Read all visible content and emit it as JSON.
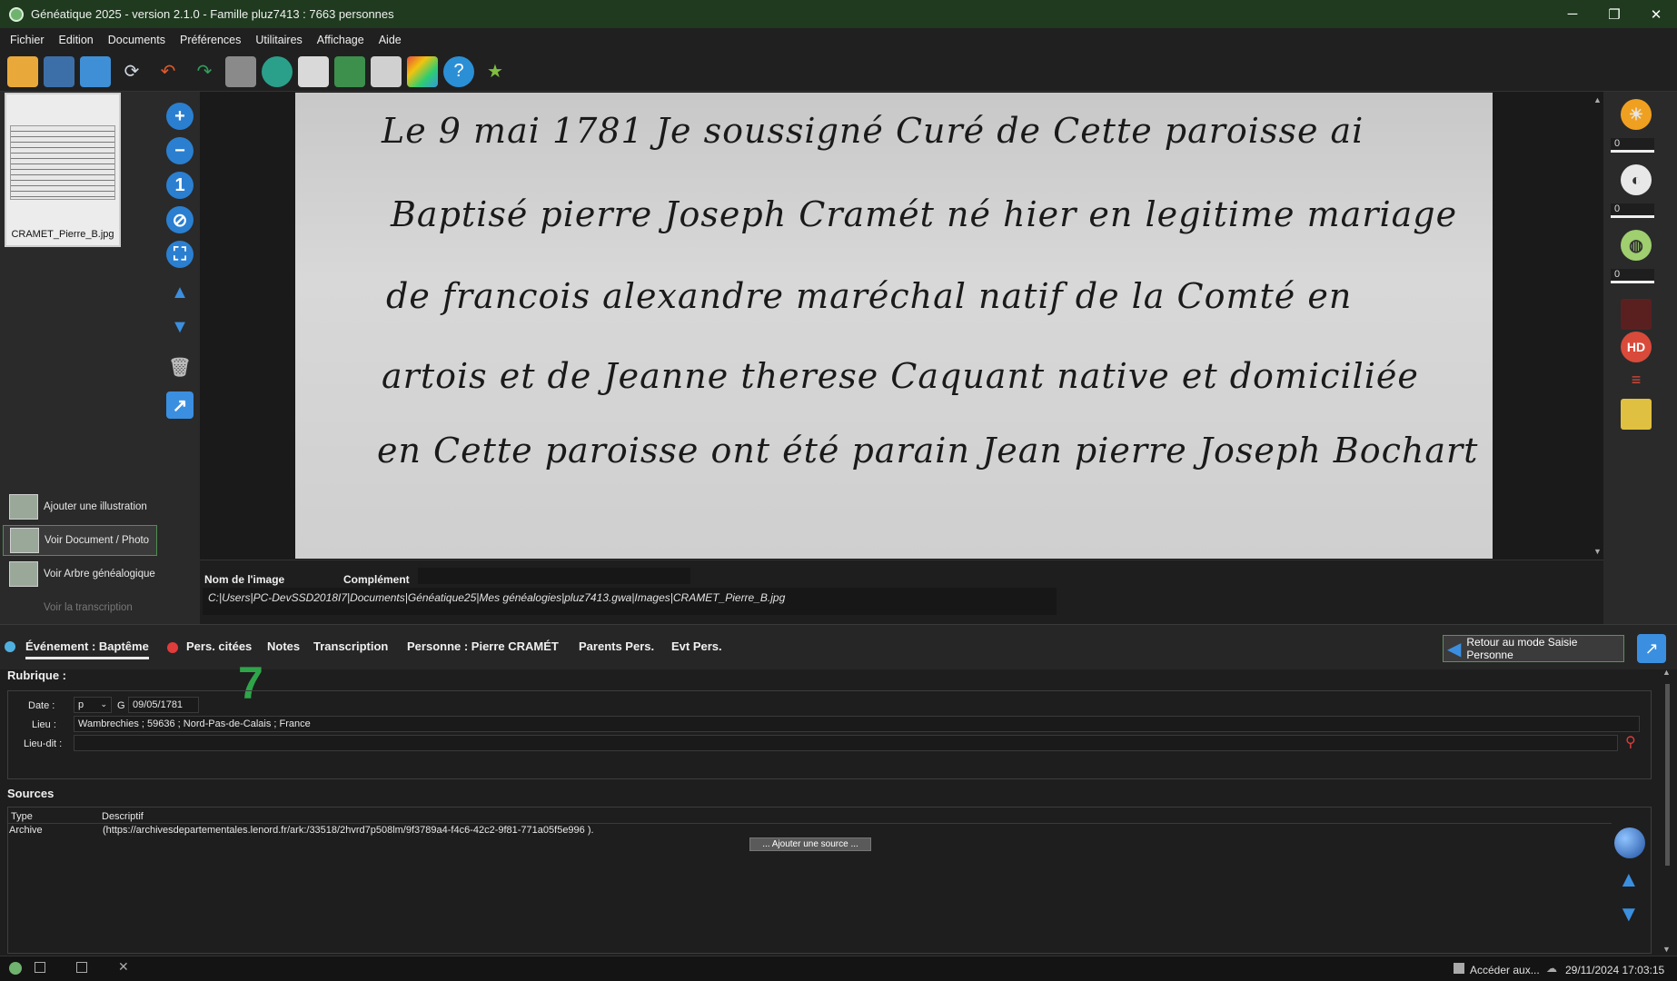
{
  "window": {
    "title": "Généatique 2025 - version 2.1.0 - Famille pluz7413 : 7663 personnes",
    "controls": {
      "minimize": "─",
      "restore": "❐",
      "close": "✕"
    }
  },
  "menu": [
    "Fichier",
    "Edition",
    "Documents",
    "Préférences",
    "Utilitaires",
    "Affichage",
    "Aide"
  ],
  "toolbar": {
    "icons": [
      "open-folder-icon",
      "save-icon",
      "download-icon",
      "sync-icon",
      "undo-icon",
      "redo-icon",
      "keyboard-icon",
      "tools-icon",
      "document-icon",
      "briefcase-icon",
      "layout-icon",
      "grid-icon",
      "help-icon",
      "tree-star-icon"
    ]
  },
  "thumbnail": {
    "caption": "CRAMET_Pierre_B.jpg"
  },
  "side_actions": [
    {
      "label": "Ajouter une illustration"
    },
    {
      "label": "Voir Document / Photo"
    },
    {
      "label": "Voir Arbre généalogique"
    },
    {
      "label": "Voir la transcription"
    }
  ],
  "document_lines": [
    "Le 9 mai 1781 Je soussigné Curé de Cette paroisse ai",
    "Baptisé pierre Joseph Cramét né hier en legitime mariage",
    "de francois alexandre maréchal natif de la Comté en",
    "artois et de Jeanne therese Caquant native et domiciliée",
    "en Cette paroisse ont été parain Jean pierre Joseph Bochart"
  ],
  "info": {
    "nom_label": "Nom de l'image",
    "complement_label": "Complément",
    "path": "C:|Users|PC-DevSSD2018I7|Documents|Généatique25|Mes généalogies|pluz7413.gwa|Images|CRAMET_Pierre_B.jpg"
  },
  "right_tools": {
    "spin1": "0",
    "spin2": "0",
    "spin3": "0",
    "hd": "HD"
  },
  "tabs": {
    "evenement": "Événement : Baptême",
    "pers_citees": "Pers. citées",
    "notes": "Notes",
    "transcription": "Transcription",
    "personne": "Personne : Pierre CRAMÉT",
    "parents": "Parents Pers.",
    "evt": "Evt Pers.",
    "retour": "Retour au mode Saisie Personne"
  },
  "badge": "7",
  "rubrique": {
    "title": "Rubrique :",
    "date_label": "Date :",
    "date_prefix": "p",
    "calendar": "G",
    "date_value": "09/05/1781",
    "lieu_label": "Lieu :",
    "lieu_value": "Wambrechies ; 59636 ; Nord-Pas-de-Calais ; France",
    "lieudit_label": "Lieu-dit :",
    "lieudit_value": ""
  },
  "sources": {
    "title": "Sources",
    "col_type": "Type",
    "col_descriptif": "Descriptif",
    "rows": [
      {
        "type": "Archive",
        "descriptif": "(https://archivesdepartementales.lenord.fr/ark:/33518/2hvrd7p508lm/9f3789a4-f4c6-42c2-9f81-771a05f5e996 )."
      }
    ],
    "add_button": "... Ajouter une source ..."
  },
  "statusbar": {
    "acceder": "Accéder aux...",
    "datetime": "29/11/2024 17:03:15"
  },
  "colors": {
    "accent": "#2fa54a",
    "bg": "#1e1e1e",
    "panel": "#2a2a2a"
  }
}
